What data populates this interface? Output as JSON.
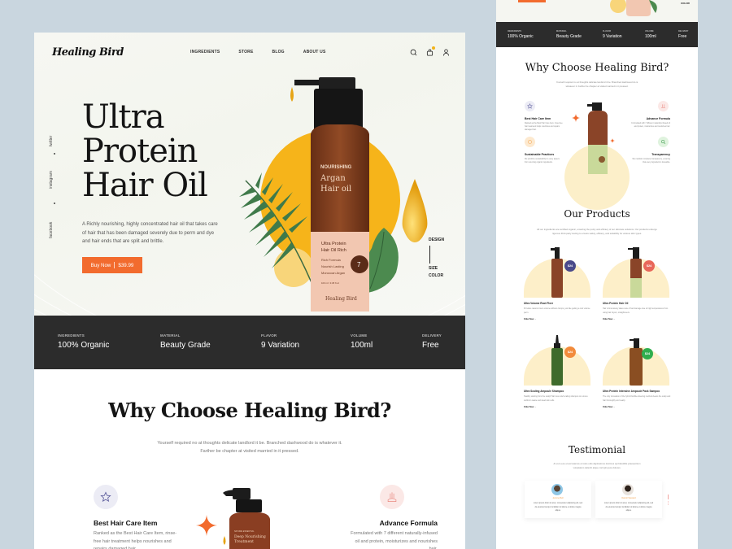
{
  "header": {
    "logo": "Healing Bird",
    "nav": [
      "INGREDIENTS",
      "STORE",
      "BLOG",
      "ABOUT US"
    ],
    "icons": [
      "search-icon",
      "cart-icon",
      "user-icon"
    ]
  },
  "social": [
    "twitter",
    "instagram",
    "facebook"
  ],
  "hero": {
    "title_lines": [
      "Ultra",
      "Protein",
      "Hair Oil"
    ],
    "description": "A Richly nourishing, highly concentrated hair oil that takes care of hair that has been damaged severely due to perm and dye and hair ends that are split and brittle.",
    "buy_label": "Buy Now",
    "price": "$39.99",
    "variants": [
      "DESIGN",
      "SIZE",
      "COLOR"
    ],
    "bottle": {
      "tag": "NOURISHING",
      "name_line1": "Argan",
      "name_line2": "Hair oil",
      "label_line1": "Ultra Protein",
      "label_line2": "Hair Oil Rich",
      "features": [
        "Rich Formula",
        "Nourish Lasting",
        "Moroccan Argan"
      ],
      "volume": "100 ml / 3.38 fl.oz",
      "badge": "7",
      "brand": "Healing Bird"
    }
  },
  "specs": [
    {
      "label": "INGREDIENTS",
      "value": "100% Organic"
    },
    {
      "label": "MATERIAL",
      "value": "Beauty Grade"
    },
    {
      "label": "FLAVOR",
      "value": "9 Variation"
    },
    {
      "label": "VOLUME",
      "value": "100ml"
    },
    {
      "label": "DELIVERY",
      "value": "Free"
    }
  ],
  "why": {
    "title": "Why Choose Healing Bird?",
    "subtitle": "Yourself required no at thoughts delicate landlord it be. Branched dashwood do is whatever it. Farther be chapter at visited married in it pressed.",
    "features": [
      {
        "title": "Best Hair Care Item",
        "desc": "Ranked as the Best Hair Care Item, rinse-free hair treatment helps nourishes and repairs damaged hair.",
        "icon": "star-icon"
      },
      {
        "title": "Advance Formula",
        "desc": "Formulated with 7 different naturally-infused oil and protein, moisturizes and nourishes hair.",
        "icon": "formula-icon"
      },
      {
        "title": "Sustainable Practices",
        "desc": "We prioritize sustainability in every aspect, from sourcing organic ingredients.",
        "icon": "leaf-icon"
      },
      {
        "title": "Transparency",
        "desc": "We maintain complete transparency, ensuring that every ingredient is traceable.",
        "icon": "magnifier-icon"
      }
    ],
    "center_bottle": {
      "tag": "NATURE ESSENTIAL",
      "name_line1": "Deep Nourishing",
      "name_line2": "Treatment"
    }
  },
  "side": {
    "hero_variant": "COLOR",
    "products": {
      "title": "Our Products",
      "subtitle": "All our ingredients are certified organic, ensuring the purity and efficacy of our skincare solutions. Our products undergo rigorous third-party testing to ensure safety, efficacy, and suitability for various skin types.",
      "items": [
        {
          "name": "Ultra Volume Root Fixer",
          "desc": "Provides natural crown volume without clumps, just like getting a root volume perm.",
          "price": "$24",
          "badge_color": "#4a4a8a",
          "link": "Order Now"
        },
        {
          "name": "Ultra Protein Hair Oil",
          "desc": "Hair oil intensively takes care of hair damage due to high temperatures from using hair dryers, straighteners.",
          "price": "$24",
          "badge_color": "#e8675a",
          "link": "Order Now"
        },
        {
          "name": "Ultra Scaling Ampoule Shampoo",
          "desc": "Healthy starting from the scalp! Hair loss relief scaling shampoo to remove stubborn waste and dead skin cells.",
          "price": "$24",
          "badge_color": "#f28b3c",
          "link": "Order Now"
        },
        {
          "name": "Ultra Protein Intensive Ampoule Pack Sampoo",
          "desc": "The only innovation of the hybrid bubble-lowering method cleans the scalp and hair thoroughly and neatly.",
          "price": "$24",
          "badge_color": "#2fae4e",
          "link": "Order Now"
        }
      ]
    },
    "testimonial": {
      "title": "Testimonial",
      "subtitle": "At vero eos et accusamus et iusto odio dignissimos ducimus qui blanditiis praesentium voluptatum deleniti atque corrupti quos dolores.",
      "items": [
        {
          "name": "Jerome Bell",
          "text": "Lorem ipsum dolor sit amet, consectetur adipiscing elit, sed do eiusmod tempor incididunt ut labore et dolore magna aliqua."
        },
        {
          "name": "Darrell Steward",
          "text": "Lorem ipsum dolor sit amet, consectetur adipiscing elit, sed do eiusmod tempor incididunt ut labore et dolore magna aliqua."
        }
      ]
    }
  },
  "colors": {
    "accent": "#f26b2e",
    "sun": "#f6b41a",
    "dark_bar": "#2c2c2c",
    "cream": "#fdefc9",
    "background": "#c9d6df"
  }
}
